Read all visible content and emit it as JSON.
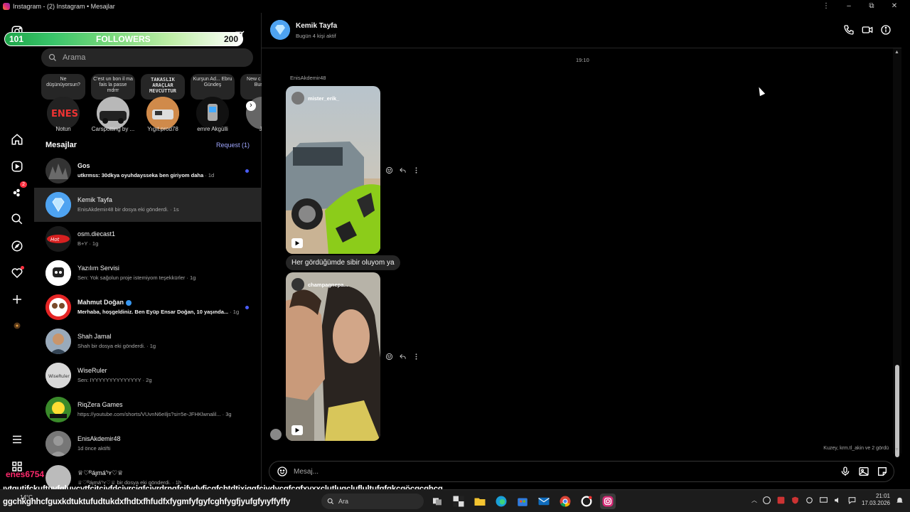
{
  "window": {
    "title": "Instagram - (2) Instagram • Mesajlar",
    "controls": [
      "⋮",
      "–",
      "⧉",
      "✕"
    ]
  },
  "followers_bar": {
    "left": "101",
    "center": "FOLLOWERS",
    "right": "200"
  },
  "search": {
    "placeholder": "Arama"
  },
  "notes": [
    {
      "bubble": "Ne düşünüyorsun?",
      "name": "Notun"
    },
    {
      "bubble": "C'est un bon il ma fais la passe mdrrr",
      "name": "Carspotting by ..."
    },
    {
      "bubble": "TAKASLIK ARAÇLAR MEVCUTTUR",
      "name": "Yıgıt.prod78"
    },
    {
      "bubble": "Kurşun Ad... Ebru Gündeş",
      "name": "emre Akgülli"
    },
    {
      "bubble": "New c coming Busy w",
      "name": "Ja"
    }
  ],
  "inbox": {
    "header": "Mesajlar",
    "request": "Request (1)"
  },
  "conversations": [
    {
      "name": "Gos",
      "preview": "utkrmss: 30dkya oyuhdaysseka ben giriyom daha",
      "time": " · 1d",
      "unread": true
    },
    {
      "name": "Kemik Tayfa",
      "preview": "EnisAkdemir48 bir dosya eki gönderdi.",
      "time": " · 1s",
      "unread": false
    },
    {
      "name": "osm.diecast1",
      "preview": "B+Y",
      "time": " · 1g",
      "unread": false
    },
    {
      "name": "Yazılım Servisi",
      "preview": "Sen: Yok sağolun proje istemiyom teşekkürler",
      "time": " · 1g",
      "unread": false
    },
    {
      "name": "Mahmut Doğan",
      "preview": "Merhaba, hoşgeldiniz. Ben Eyüp Ensar Doğan, 10 yaşında...",
      "time": " · 1g",
      "unread": true
    },
    {
      "name": "Shah Jamal",
      "preview": "Shah bir dosya eki gönderdi.",
      "time": " · 1g",
      "unread": false
    },
    {
      "name": "WiseRuler",
      "preview": "Sen: IYYYYYYYYYYYYYY",
      "time": " · 2g",
      "unread": false
    },
    {
      "name": "RiqZera Games",
      "preview": "https://youtube.com/shorts/VUvnN6eIljs?si=5e-JFHKlwnalil...",
      "time": " · 3g",
      "unread": false
    },
    {
      "name": "EnisAkdemir48",
      "preview": "1d önce aktifti",
      "time": "",
      "unread": false
    },
    {
      "name": "♕♡ᴿáȷmá'ᵗʏ♡♕",
      "preview": "♕♡ᴿáȷmá'ᵗʏ♡♕ bir dosya eki gönderdi.",
      "time": " · 1h",
      "unread": false
    }
  ],
  "chat": {
    "name": "Kemik Tayfa",
    "status": "Bugün 4 kişi aktif",
    "time": "19:10",
    "sender": "EnisAkdemir48",
    "media1_user": "mister_erik_",
    "text": "Her gördüğümde sibir oluyom ya",
    "media2_user": "champagnepa...",
    "seen": "Kuzey, krm.tl_akin ve 2 gördü",
    "composer_placeholder": "Mesaj..."
  },
  "overlay": {
    "line1": "ıytgutjfckuftuyfgluycytfcjtcjyfdcjyrcjgfcjyrdrngfcjfydyfjcgfchtdtjxjggfcjydycgfcgfxyxxclutlugcluflultufgfgkcgöcgcghcg",
    "line2": "ggchkghhcfguxkdtuktufudtukdxfhdtxfhfudfxfygmfyfgyfcghfygfjyufgfyıyffyffy",
    "username": "enes6754"
  },
  "taskbar": {
    "search": "Ara",
    "weather": "14°C",
    "time": "21:01",
    "date": "17.03.2026"
  }
}
